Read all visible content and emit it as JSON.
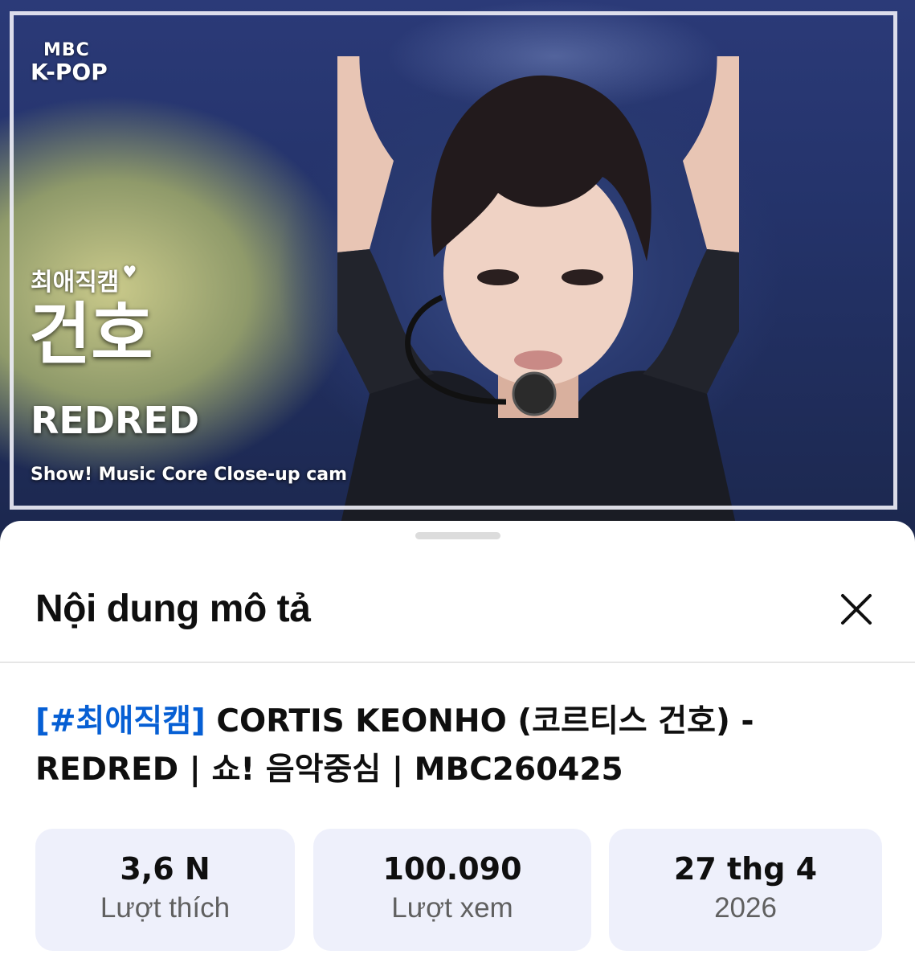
{
  "thumbnail": {
    "logo_line1": "MBC",
    "logo_line2": "K-POP",
    "cam_tag": "최애직캠",
    "member_name": "건호",
    "song": "REDRED",
    "caption": "Show! Music Core Close-up cam"
  },
  "sheet": {
    "title": "Nội dung mô tả",
    "close_icon": "close-icon",
    "video_title_hashtag": "[#최애직캠]",
    "video_title_rest": " CORTIS KEONHO (코르티스 건호) - REDRED | 쇼! 음악중심 | MBC260425",
    "stats": [
      {
        "value": "3,6 N",
        "label": "Lượt thích"
      },
      {
        "value": "100.090",
        "label": "Lượt xem"
      },
      {
        "value": "27 thg 4",
        "label": "2026"
      }
    ]
  },
  "colors": {
    "link": "#065fd4",
    "card_bg": "#eef0fb",
    "sheet_bg": "#ffffff"
  }
}
